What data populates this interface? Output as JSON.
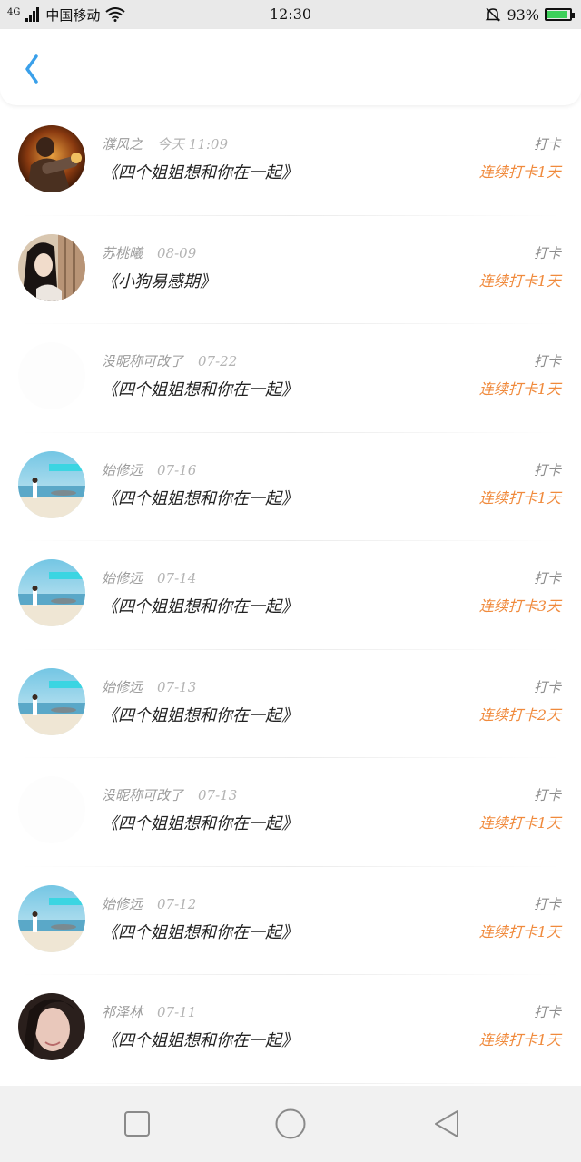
{
  "status_bar": {
    "network": "4G",
    "carrier": "中国移动",
    "time": "12:30",
    "battery": "93%",
    "battery_level": 0.93
  },
  "feed": {
    "items": [
      {
        "username": "濮风之",
        "date": "今天 11:09",
        "book": "《四个姐姐想和你在一起》",
        "tag": "打卡",
        "streak": "连续打卡1天",
        "avatar": "warrior-avatar"
      },
      {
        "username": "苏桃曦",
        "date": "08-09",
        "book": "《小狗易感期》",
        "tag": "打卡",
        "streak": "连续打卡1天",
        "avatar": "portrait-avatar"
      },
      {
        "username": "没昵称可改了",
        "date": "07-22",
        "book": "《四个姐姐想和你在一起》",
        "tag": "打卡",
        "streak": "连续打卡1天",
        "avatar": "blank-avatar"
      },
      {
        "username": "始修远",
        "date": "07-16",
        "book": "《四个姐姐想和你在一起》",
        "tag": "打卡",
        "streak": "连续打卡1天",
        "avatar": "beach-avatar"
      },
      {
        "username": "始修远",
        "date": "07-14",
        "book": "《四个姐姐想和你在一起》",
        "tag": "打卡",
        "streak": "连续打卡3天",
        "avatar": "beach-avatar"
      },
      {
        "username": "始修远",
        "date": "07-13",
        "book": "《四个姐姐想和你在一起》",
        "tag": "打卡",
        "streak": "连续打卡2天",
        "avatar": "beach-avatar"
      },
      {
        "username": "没昵称可改了",
        "date": "07-13",
        "book": "《四个姐姐想和你在一起》",
        "tag": "打卡",
        "streak": "连续打卡1天",
        "avatar": "blank-avatar"
      },
      {
        "username": "始修远",
        "date": "07-12",
        "book": "《四个姐姐想和你在一起》",
        "tag": "打卡",
        "streak": "连续打卡1天",
        "avatar": "beach-avatar"
      },
      {
        "username": "祁泽林",
        "date": "07-11",
        "book": "《四个姐姐想和你在一起》",
        "tag": "打卡",
        "streak": "连续打卡1天",
        "avatar": "selfie-avatar"
      }
    ]
  },
  "colors": {
    "accent_blue": "#3aa0ea",
    "streak_orange": "#f08a3c"
  }
}
